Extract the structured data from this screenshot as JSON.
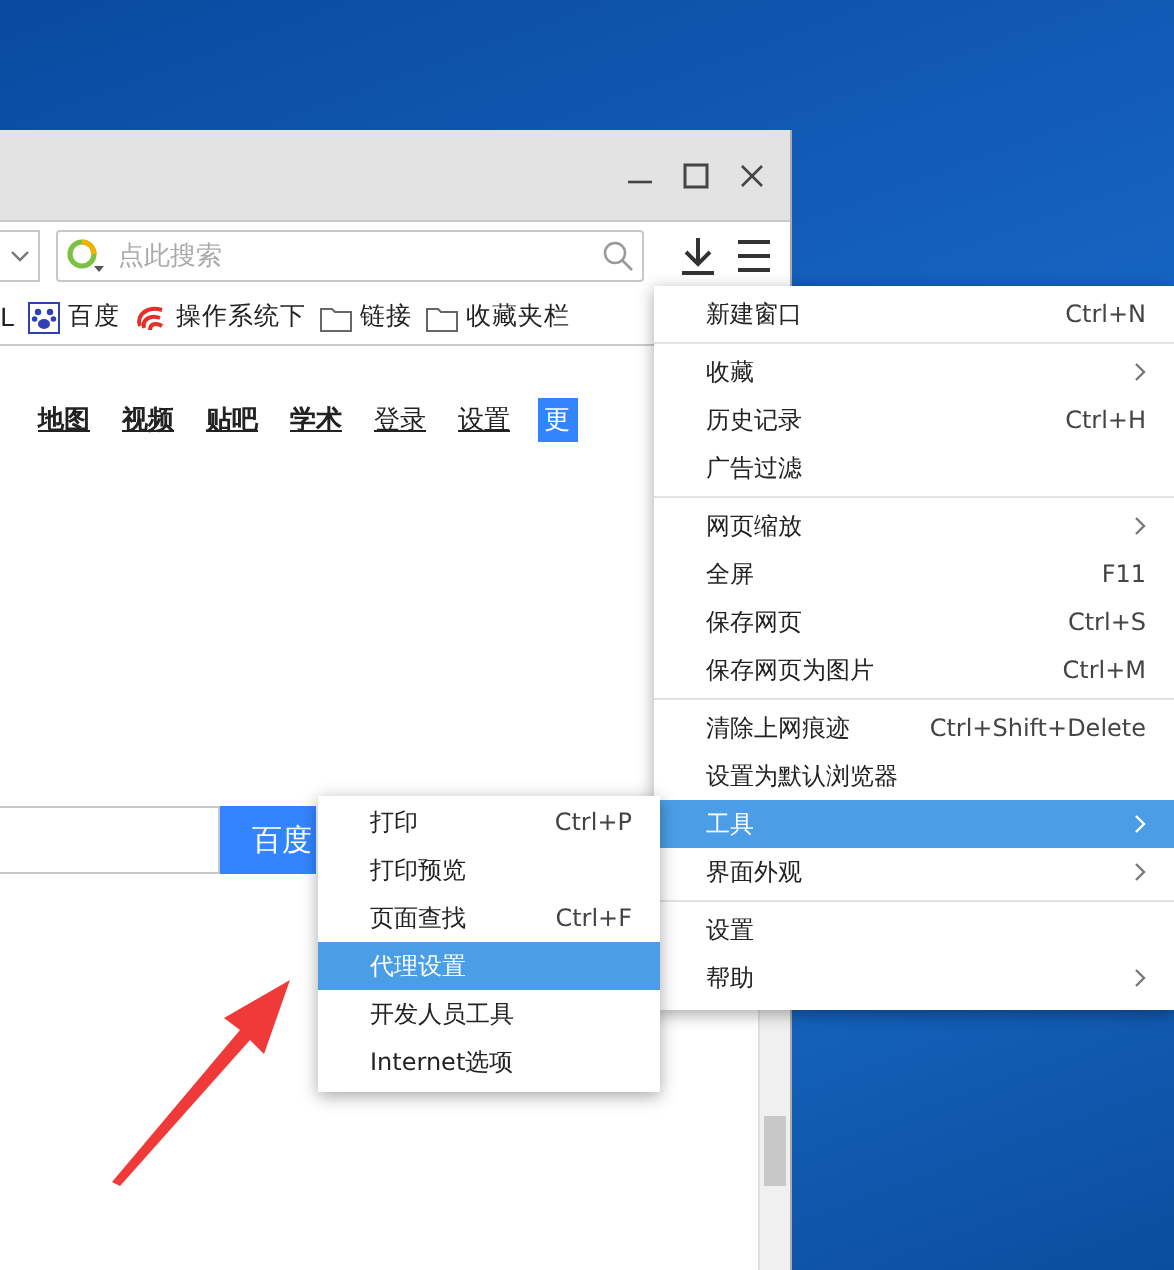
{
  "toolbar": {
    "search": {
      "placeholder": "点此搜索"
    }
  },
  "bookmarks": [
    {
      "label": "L",
      "kind": "plain"
    },
    {
      "label": "百度",
      "kind": "paw"
    },
    {
      "label": "操作系统下",
      "kind": "swirl"
    },
    {
      "label": "链接",
      "kind": "folder"
    },
    {
      "label": "收藏夹栏",
      "kind": "folder"
    }
  ],
  "page": {
    "nav_links": [
      {
        "label": "地图",
        "bold": true
      },
      {
        "label": "视频",
        "bold": true
      },
      {
        "label": "贴吧",
        "bold": true
      },
      {
        "label": "学术",
        "bold": true
      },
      {
        "label": "登录",
        "bold": false
      },
      {
        "label": "设置",
        "bold": false
      }
    ],
    "more_button": "更",
    "search_button": "百度"
  },
  "menu": {
    "groups": [
      [
        {
          "label": "新建窗口",
          "shortcut": "Ctrl+N",
          "submenu": false,
          "selected": false
        }
      ],
      [
        {
          "label": "收藏",
          "submenu": true,
          "selected": false
        },
        {
          "label": "历史记录",
          "shortcut": "Ctrl+H",
          "submenu": false,
          "selected": false
        },
        {
          "label": "广告过滤",
          "submenu": false,
          "selected": false
        }
      ],
      [
        {
          "label": "网页缩放",
          "submenu": true,
          "selected": false
        },
        {
          "label": "全屏",
          "shortcut": "F11",
          "submenu": false,
          "selected": false
        },
        {
          "label": "保存网页",
          "shortcut": "Ctrl+S",
          "submenu": false,
          "selected": false
        },
        {
          "label": "保存网页为图片",
          "shortcut": "Ctrl+M",
          "submenu": false,
          "selected": false
        }
      ],
      [
        {
          "label": "清除上网痕迹",
          "shortcut": "Ctrl+Shift+Delete",
          "submenu": false,
          "selected": false
        },
        {
          "label": "设置为默认浏览器",
          "submenu": false,
          "selected": false
        },
        {
          "label": "工具",
          "submenu": true,
          "selected": true
        },
        {
          "label": "界面外观",
          "submenu": true,
          "selected": false
        }
      ],
      [
        {
          "label": "设置",
          "submenu": false,
          "selected": false
        },
        {
          "label": "帮助",
          "submenu": true,
          "selected": false
        }
      ]
    ]
  },
  "submenu": {
    "items": [
      {
        "label": "打印",
        "shortcut": "Ctrl+P",
        "selected": false
      },
      {
        "label": "打印预览",
        "selected": false
      },
      {
        "label": "页面查找",
        "shortcut": "Ctrl+F",
        "selected": false
      },
      {
        "label": "代理设置",
        "selected": true
      },
      {
        "label": "开发人员工具",
        "selected": false
      },
      {
        "label": "Internet选项",
        "selected": false
      }
    ]
  }
}
